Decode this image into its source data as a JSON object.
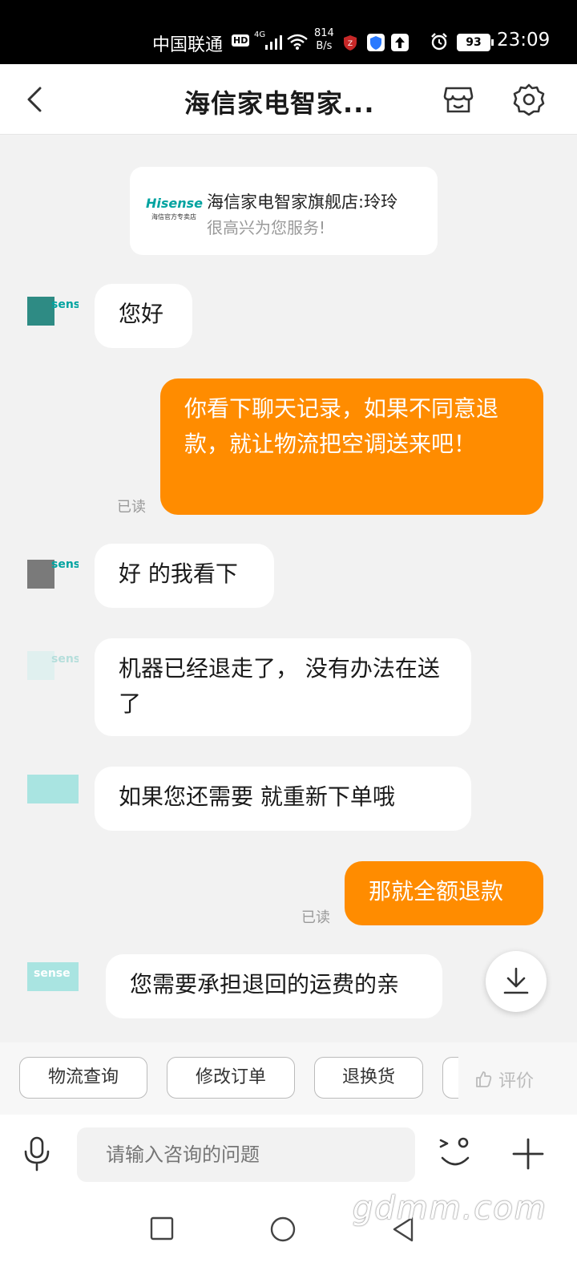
{
  "status_bar": {
    "carrier": "中国联通",
    "hd": "HD",
    "network": "4G",
    "speed_value": "814",
    "speed_unit": "B/s",
    "battery": "93",
    "time": "23:09"
  },
  "header": {
    "title": "海信家电智家..."
  },
  "store_card": {
    "brand": "Hisense",
    "brand_sub": "海信官方专卖店",
    "line1": "海信家电智家旗舰店:玲玲",
    "line2": "很高兴为您服务!"
  },
  "messages": [
    {
      "side": "in",
      "text": "您好"
    },
    {
      "side": "out",
      "text": "你看下聊天记录，如果不同意退款，就让物流把空调送来吧！",
      "read": "已读"
    },
    {
      "side": "in",
      "text": "好 的我看下"
    },
    {
      "side": "in",
      "text": "机器已经退走了， 没有办法在送了"
    },
    {
      "side": "in",
      "text": "如果您还需要  就重新下单哦"
    },
    {
      "side": "out",
      "text": "那就全额退款",
      "read": "已读"
    },
    {
      "side": "in",
      "text": "您需要承担退回的运费的亲"
    }
  ],
  "avatar_text": "sense",
  "quick_actions": [
    "物流查询",
    "修改订单",
    "退换货"
  ],
  "rate_label": "评价",
  "input": {
    "placeholder": "请输入咨询的问题"
  },
  "watermark": "gdmm.com",
  "colors": {
    "accent": "#ff8c00",
    "brand": "#00a3a0",
    "background": "#f2f2f2"
  }
}
